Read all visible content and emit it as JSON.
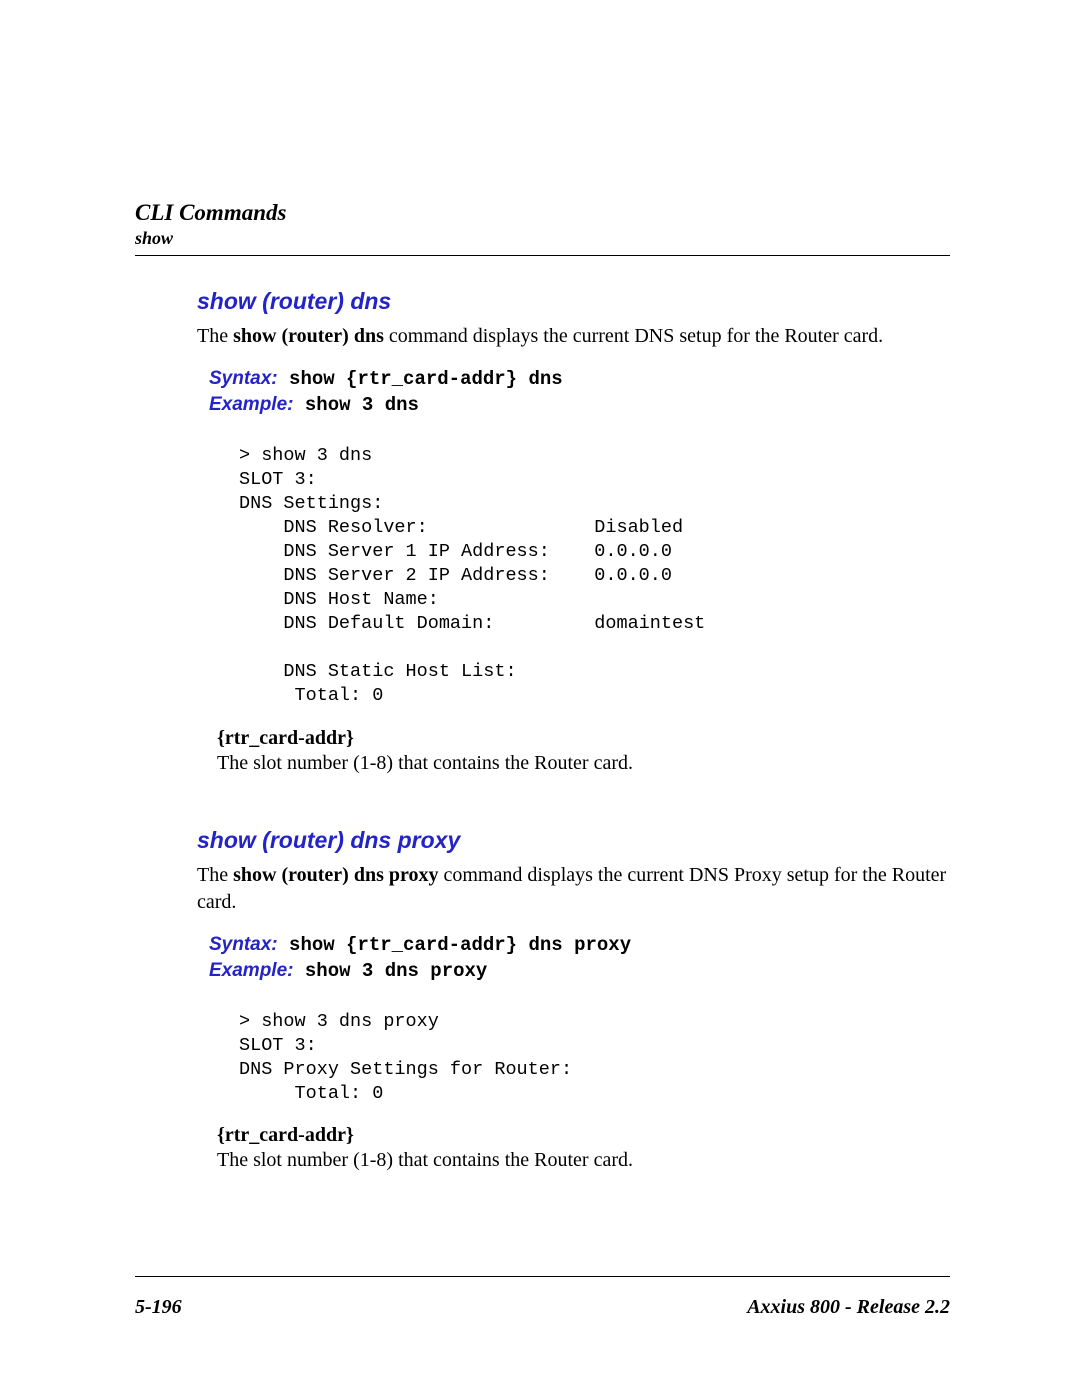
{
  "header": {
    "title": "CLI Commands",
    "subtitle": "show"
  },
  "sections": [
    {
      "heading": "show (router) dns",
      "intro_pre": "The ",
      "intro_cmd": "show (router) dns",
      "intro_post": " command displays the current DNS setup for the Router card.",
      "syntax_label": "Syntax:",
      "syntax_code": " show {rtr_card-addr} dns",
      "example_label": "Example:",
      "example_code": " show 3 dns",
      "snippet": "> show 3 dns\nSLOT 3:\nDNS Settings:\n    DNS Resolver:               Disabled\n    DNS Server 1 IP Address:    0.0.0.0\n    DNS Server 2 IP Address:    0.0.0.0\n    DNS Host Name:\n    DNS Default Domain:         domaintest\n\n    DNS Static Host List:\n     Total: 0",
      "param_name": "{rtr_card-addr}",
      "param_desc": "The slot number (1-8) that contains the Router card."
    },
    {
      "heading": "show (router) dns proxy",
      "intro_pre": "The ",
      "intro_cmd": "show (router) dns proxy",
      "intro_post": " command displays the current DNS Proxy setup for the Router card.",
      "syntax_label": "Syntax:",
      "syntax_code": " show {rtr_card-addr} dns proxy",
      "example_label": "Example:",
      "example_code": " show 3 dns proxy",
      "snippet": "> show 3 dns proxy\nSLOT 3:\nDNS Proxy Settings for Router:\n     Total: 0",
      "param_name": "{rtr_card-addr}",
      "param_desc": "The slot number (1-8) that contains the Router card."
    }
  ],
  "footer": {
    "page": "5-196",
    "product": "Axxius 800 - Release 2.2"
  }
}
